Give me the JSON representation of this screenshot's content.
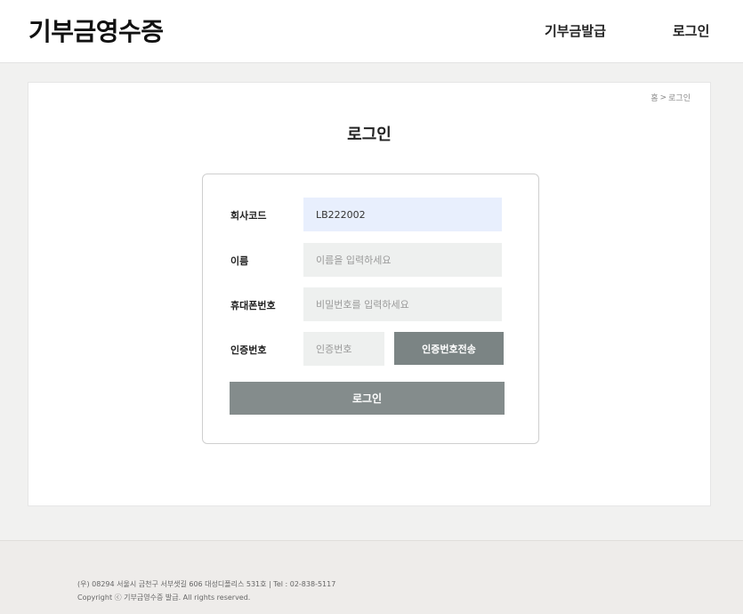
{
  "header": {
    "logo": "기부금영수증",
    "nav": {
      "issue": "기부금발급",
      "login": "로그인"
    }
  },
  "breadcrumb": {
    "home": "홈",
    "separator": ">",
    "current": "로그인"
  },
  "page": {
    "title": "로그인"
  },
  "form": {
    "company_code": {
      "label": "회사코드",
      "value": "LB222002"
    },
    "name": {
      "label": "이름",
      "placeholder": "이름을 입력하세요"
    },
    "phone": {
      "label": "휴대폰번호",
      "placeholder": "비밀번호를 입력하세요"
    },
    "auth": {
      "label": "인증번호",
      "placeholder": "인증번호",
      "send_label": "인증번호전송"
    },
    "submit_label": "로그인"
  },
  "footer": {
    "address": "(우) 08294 서울시 금천구 서부샛길 606 대성디폴리스 531호 | Tel : 02-838-5117",
    "copyright": "Copyright ⓒ 기부금영수증 발급. All rights reserved."
  },
  "colors": {
    "button_gray": "#848c8c",
    "input_bg": "#eef0ef",
    "input_filled_bg": "#e8effd"
  }
}
